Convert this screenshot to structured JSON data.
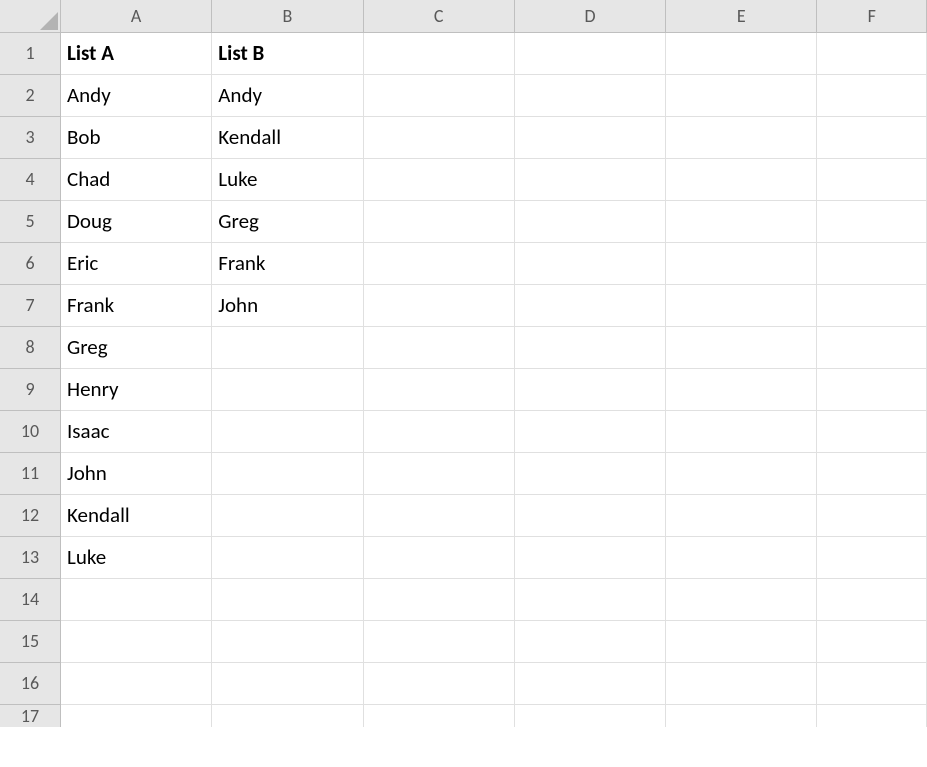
{
  "columns": [
    "A",
    "B",
    "C",
    "D",
    "E",
    "F"
  ],
  "rows": [
    "1",
    "2",
    "3",
    "4",
    "5",
    "6",
    "7",
    "8",
    "9",
    "10",
    "11",
    "12",
    "13",
    "14",
    "15",
    "16",
    "17"
  ],
  "headers": {
    "A": "List A",
    "B": "List B"
  },
  "data": {
    "A": [
      "Andy",
      "Bob",
      "Chad",
      "Doug",
      "Eric",
      "Frank",
      "Greg",
      "Henry",
      "Isaac",
      "John",
      "Kendall",
      "Luke"
    ],
    "B": [
      "Andy",
      "Kendall",
      "Luke",
      "Greg",
      "Frank",
      "John"
    ]
  }
}
